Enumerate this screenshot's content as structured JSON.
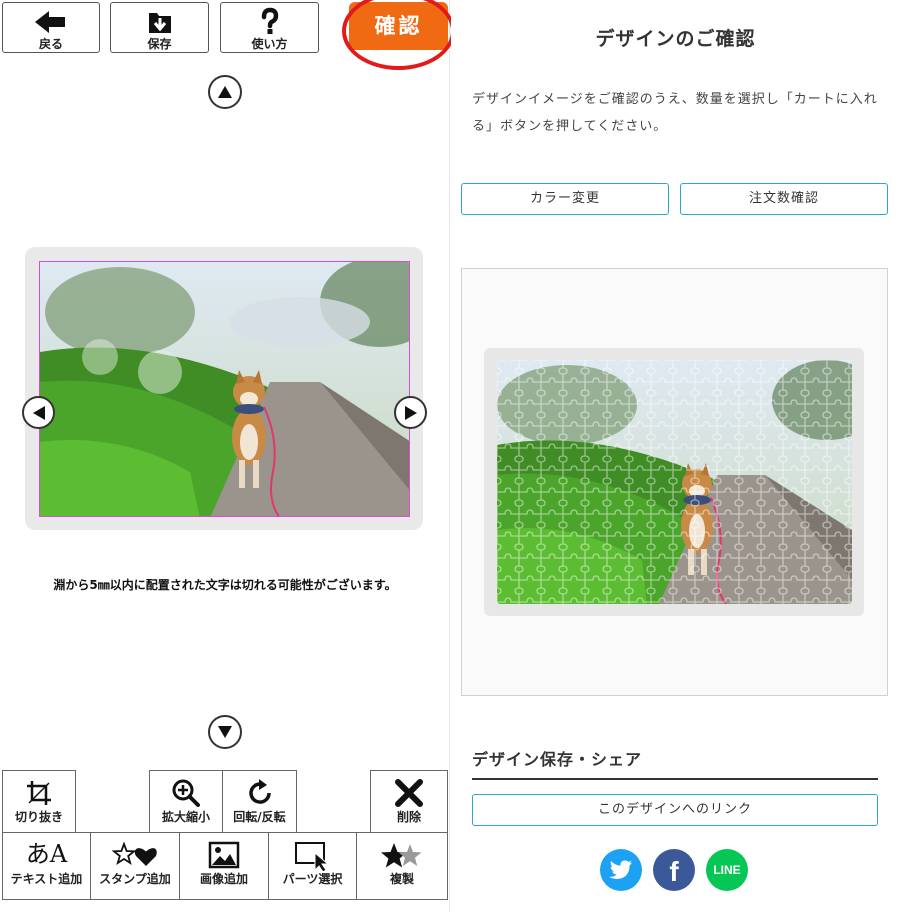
{
  "toolbar": {
    "back_label": "戻る",
    "save_label": "保存",
    "help_label": "使い方",
    "confirm_label": "確認"
  },
  "editor": {
    "notice": "淵から5㎜以内に配置された文字は切れる可能性がございます。"
  },
  "tools": {
    "crop": "切り抜き",
    "zoom": "拡大縮小",
    "rotate": "回転/反転",
    "delete": "削除",
    "add_text": "テキスト追加",
    "add_stamp": "スタンプ追加",
    "add_image": "画像追加",
    "select_parts": "パーツ選択",
    "duplicate": "複製",
    "text_icon_glyph": "あA"
  },
  "confirm_panel": {
    "title": "デザインのご確認",
    "description": "デザインイメージをご確認のうえ、数量を選択し「カートに入れる」ボタンを押してください。",
    "color_change_label": "カラー変更",
    "order_qty_label": "注文数確認",
    "share_title": "デザイン保存・シェア",
    "link_label": "このデザインへのリンク",
    "sns": {
      "twitter_glyph": "",
      "facebook_glyph": "f",
      "line_label": "LINE"
    }
  },
  "colors": {
    "accent_orange": "#f06a13",
    "highlight_red": "#e21a1a",
    "outline_blue": "#2aa9c6",
    "twitter": "#1da1f2",
    "facebook": "#3b5998",
    "line": "#06c755"
  },
  "icons": [
    "back-arrow-icon",
    "save-icon",
    "question-icon",
    "chevron-up-icon",
    "chevron-down-icon",
    "chevron-left-icon",
    "chevron-right-icon",
    "crop-icon",
    "zoom-icon",
    "rotate-icon",
    "delete-icon",
    "text-icon",
    "stamp-icon",
    "image-icon",
    "parts-select-icon",
    "duplicate-icon",
    "twitter-icon",
    "facebook-icon",
    "line-icon"
  ]
}
